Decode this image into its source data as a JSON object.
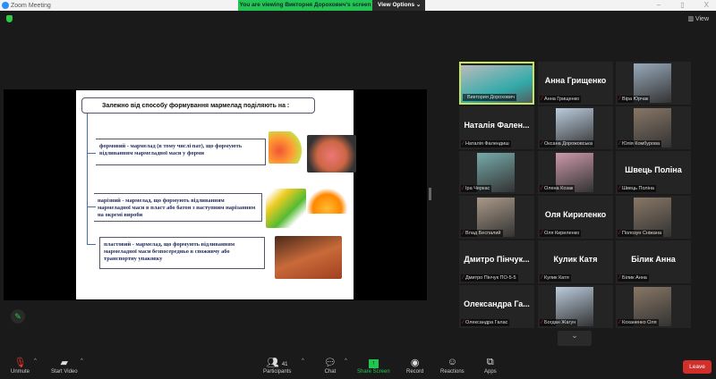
{
  "window": {
    "title": "Zoom Meeting",
    "minimize": "–",
    "maximize": "▯",
    "close": "X"
  },
  "banner": {
    "text": "You are viewing Викторня Дорохович's screen",
    "view_options": "View Options ⌄"
  },
  "view_button": "View",
  "slide": {
    "heading": "Залежно від способу формування мармелад поділяють на :",
    "items": [
      "формовий - мармелад (в тому числі пат), що формують відливанням мармеладної маси у форми",
      "нарізний - мармелад, що формують відливанням мармеладної маси в пласт або батон з наступним нарізанням на окремі вироби",
      "пластовий - мармелад, що формують відливанням мармеладної маси безпосередньо в споживчу або транспортну упаковку"
    ]
  },
  "participants": [
    {
      "name": "Виктория Дорохович",
      "video": true,
      "active": true
    },
    {
      "name": "Анна Грищенко",
      "display": "Анна Грищенко",
      "video": false
    },
    {
      "name": "Віра Юрчак",
      "video": true
    },
    {
      "name": "Наталія Фалендиш",
      "display": "Наталія Фален...",
      "video": false
    },
    {
      "name": "Оксана Дорожовська",
      "video": true
    },
    {
      "name": "Юлія Комбурова",
      "video": true
    },
    {
      "name": "Іра Черкас",
      "video": true
    },
    {
      "name": "Олена Козак",
      "video": true
    },
    {
      "name": "Швець Поліна",
      "display": "Швець Поліна",
      "video": false
    },
    {
      "name": "Влад Беспалий",
      "video": true
    },
    {
      "name": "Оля Кириленко",
      "display": "Оля Кириленко",
      "video": false
    },
    {
      "name": "Полозун Сніжана",
      "video": true
    },
    {
      "name": "Дмитро Пінчук ПО-5-5",
      "display": "Дмитро Пінчук...",
      "video": false
    },
    {
      "name": "Кулик Катя",
      "display": "Кулик Катя",
      "video": false
    },
    {
      "name": "Білик Анна",
      "display": "Білик Анна",
      "video": false
    },
    {
      "name": "Олександра Галас",
      "display": "Олександра Га...",
      "video": false
    },
    {
      "name": "Богдан Жагун",
      "video": true
    },
    {
      "name": "Коханенко Оля",
      "video": true
    }
  ],
  "toolbar": {
    "unmute": "Unmute",
    "start_video": "Start Video",
    "participants": "Participants",
    "participant_count": "41",
    "chat": "Chat",
    "share": "Share Screen",
    "record": "Record",
    "reactions": "Reactions",
    "apps": "Apps",
    "leave": "Leave"
  },
  "colors": {
    "accent_green": "#23c552",
    "leave_red": "#d1302a",
    "active_speaker": "#c8e45a"
  }
}
